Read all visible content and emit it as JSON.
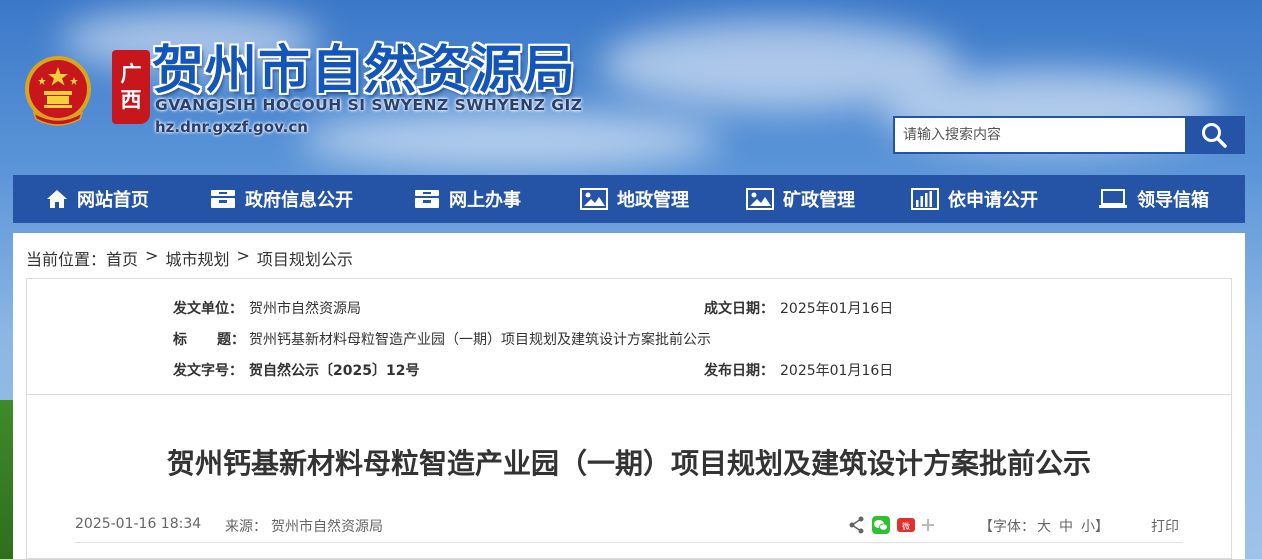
{
  "header": {
    "title": "贺州市自然资源局",
    "subtitle": "GVANGJSIH HOCOUH SI SWYENZ SWHYENZ GIZ",
    "domain": "hz.dnr.gxzf.gov.cn",
    "province_seal": [
      "广",
      "西"
    ]
  },
  "search": {
    "placeholder": "请输入搜索内容"
  },
  "nav": [
    {
      "label": "网站首页",
      "icon": "home-icon"
    },
    {
      "label": "政府信息公开",
      "icon": "archive-icon"
    },
    {
      "label": "网上办事",
      "icon": "archive-icon"
    },
    {
      "label": "地政管理",
      "icon": "image-icon"
    },
    {
      "label": "矿政管理",
      "icon": "image-icon"
    },
    {
      "label": "依申请公开",
      "icon": "bar-chart-icon"
    },
    {
      "label": "领导信箱",
      "icon": "laptop-icon"
    }
  ],
  "breadcrumb": {
    "prefix": "当前位置：",
    "items": [
      "首页",
      "城市规划",
      "项目规划公示"
    ],
    "separator": ">"
  },
  "meta": {
    "issuer_label": "发文单位：",
    "issuer": "贺州市自然资源局",
    "date_label": "成文日期：",
    "date": "2025年01月16日",
    "title_label_1": "标",
    "title_label_2": "题：",
    "title": "贺州钙基新材料母粒智造产业园（一期）项目规划及建筑设计方案批前公示",
    "docno_label": "发文字号：",
    "docno": "贺自然公示〔2025〕12号",
    "publish_label": "发布日期：",
    "publish_date": "2025年01月16日"
  },
  "article": {
    "title": "贺州钙基新材料母粒智造产业园（一期）项目规划及建筑设计方案批前公示",
    "datetime": "2025-01-16 18:34",
    "source_label": "来源：",
    "source": "贺州市自然资源局",
    "font_label_open": "【字体：",
    "font_large": "大",
    "font_medium": "中",
    "font_small": "小",
    "font_label_close": "】",
    "print": "打印",
    "share_weibo": "微"
  },
  "colors": {
    "nav_bg": "#2553a6",
    "title_blue": "#1456b8",
    "emblem_red": "#c8161d"
  }
}
